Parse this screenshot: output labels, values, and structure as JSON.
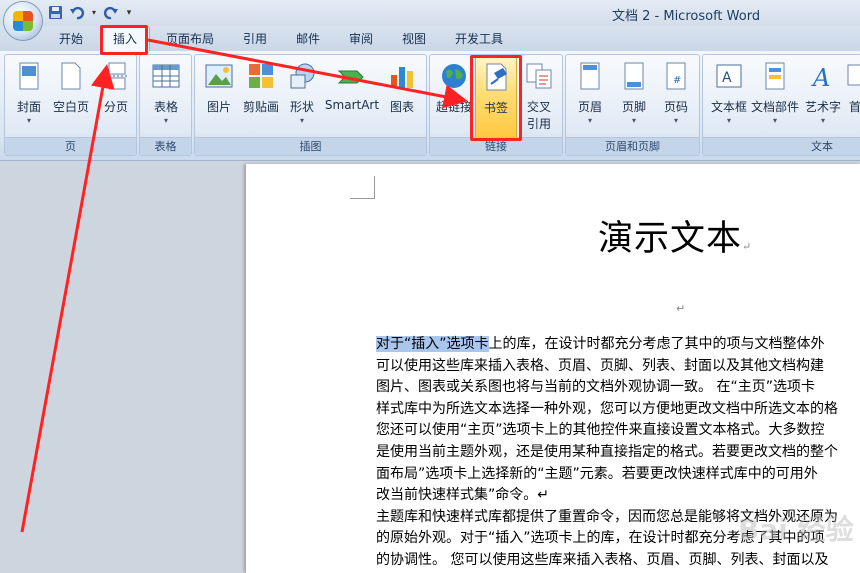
{
  "window": {
    "title": "文档 2 - Microsoft Word"
  },
  "quick_access": {
    "save_icon": "save-icon",
    "undo_icon": "undo-icon",
    "redo_icon": "redo-icon",
    "customize": "▾"
  },
  "tabs": [
    "开始",
    "插入",
    "页面布局",
    "引用",
    "邮件",
    "审阅",
    "视图",
    "开发工具"
  ],
  "active_tab": "插入",
  "ribbon": {
    "groups": {
      "pages": "页",
      "tables": "表格",
      "illustrations": "插图",
      "links": "链接",
      "header_footer": "页眉和页脚",
      "text": "文本"
    },
    "buttons": {
      "cover": "封面",
      "blank_page": "空白页",
      "page_break": "分页",
      "table": "表格",
      "picture": "图片",
      "clipart": "剪贴画",
      "shapes": "形状",
      "smartart": "SmartArt",
      "chart": "图表",
      "hyperlink": "超链接",
      "bookmark": "书签",
      "crossref_line1": "交叉",
      "crossref_line2": "引用",
      "header": "页眉",
      "footer": "页脚",
      "page_number": "页码",
      "textbox": "文本框",
      "quickparts": "文档部件",
      "wordart": "艺术字",
      "dropcap": "首"
    }
  },
  "document": {
    "title": "演示文本",
    "para_mark": "↵",
    "highlighted": "对于“插入”选项卡",
    "lines": [
      "上的库，在设计时都充分考虑了其中的项与文档整体外",
      "可以使用这些库来插入表格、页眉、页脚、列表、封面以及其他文档构建",
      "图片、图表或关系图也将与当前的文档外观协调一致。 在“主页”选项卡",
      "样式库中为所选文本选择一种外观，您可以方便地更改文档中所选文本的格",
      "您还可以使用“主页”选项卡上的其他控件来直接设置文本格式。大多数控",
      "是使用当前主题外观，还是使用某种直接指定的格式。若要更改文档的整个",
      "面布局”选项卡上选择新的“主题”元素。若要更改快速样式库中的可用外",
      "改当前快速样式集”命令。↵",
      "主题库和快速样式库都提供了重置命令，因而您总是能够将文档外观还原为",
      "的原始外观。对于“插入”选项卡上的库，在设计时都充分考虑了其中的项",
      "的协调性。 您可以使用这些库来插入表格、页眉、页脚、列表、封面以及"
    ],
    "watermark": "Bai 经验"
  }
}
